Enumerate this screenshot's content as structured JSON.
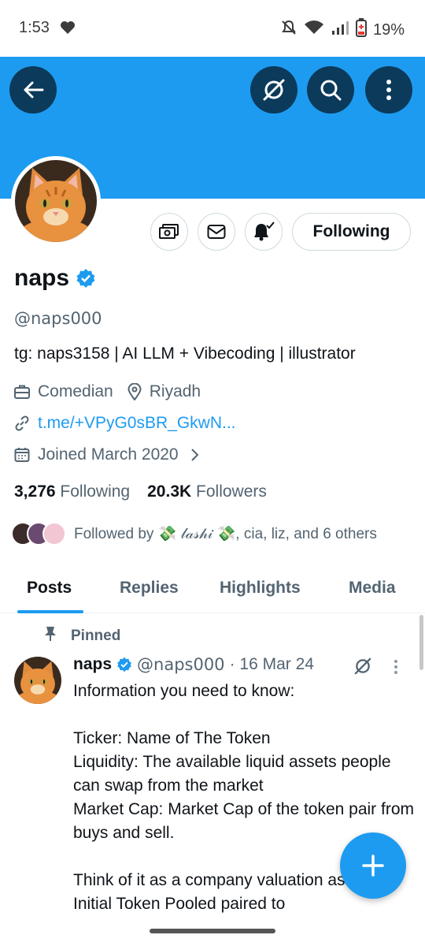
{
  "status_bar": {
    "time": "1:53",
    "battery": "19%"
  },
  "profile": {
    "name": "naps",
    "handle": "@naps000",
    "bio": "tg: naps3158 | AI LLM + Vibecoding | illustrator",
    "profession": "Comedian",
    "location": "Riyadh",
    "link": "t.me/+VPyG0sBR_GkwN...",
    "joined": "Joined March 2020",
    "following_count": "3,276",
    "following_label": "Following",
    "followers_count": "20.3K",
    "followers_label": "Followers",
    "followed_by": "Followed by 💸 𝓁𝒶𝓈𝒽𝒾 💸, cia, liz, and 6 others",
    "follow_button_label": "Following",
    "verified_color": "#1d9bf0"
  },
  "tabs": [
    {
      "label": "Posts"
    },
    {
      "label": "Replies"
    },
    {
      "label": "Highlights"
    },
    {
      "label": "Media"
    }
  ],
  "tweet": {
    "pinned_label": "Pinned",
    "name": "naps",
    "handle": "@naps000",
    "date": "· 16 Mar 24",
    "body": "Information you need to know:\n\nTicker: Name of The Token\nLiquidity: The available liquid assets people can swap from the market\nMarket Cap: Market Cap of the token pair from buys and sell.\n\nThink of it as a company valuation as that.  Initial Token Pooled paired to"
  },
  "colors": {
    "accent": "#1d9bf0",
    "banner": "#1d9bf0",
    "icon_button_bg": "#0b3a5a"
  }
}
